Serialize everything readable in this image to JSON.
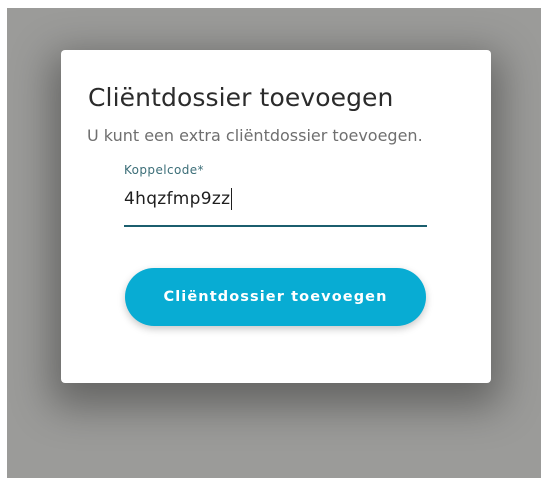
{
  "dialog": {
    "title": "Cliëntdossier toevoegen",
    "subtitle": "U kunt een extra cliëntdossier toevoegen.",
    "field": {
      "label": "Koppelcode*",
      "value": "4hqzfmp9zz"
    },
    "submit_label": "Cliëntdossier toevoegen"
  },
  "colors": {
    "accent": "#08acd3",
    "field_underline": "#1b5e6e",
    "field_label": "#3c6e78",
    "backdrop": "#9b9b99"
  }
}
